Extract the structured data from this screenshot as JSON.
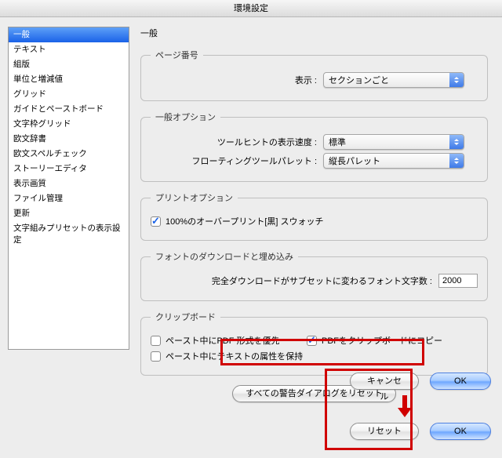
{
  "window": {
    "title": "環境設定"
  },
  "sidebar": {
    "items": [
      "一般",
      "テキスト",
      "組版",
      "単位と増減値",
      "グリッド",
      "ガイドとペーストボード",
      "文字枠グリッド",
      "欧文辞書",
      "欧文スペルチェック",
      "ストーリーエディタ",
      "表示画質",
      "ファイル管理",
      "更新",
      "文字組みプリセットの表示設定"
    ],
    "selectedIndex": 0
  },
  "main": {
    "heading": "一般",
    "pageNumber": {
      "legend": "ページ番号",
      "display_label": "表示 :",
      "value": "セクションごと"
    },
    "general": {
      "legend": "一般オプション",
      "tooltip_label": "ツールヒントの表示速度 :",
      "tooltip_value": "標準",
      "floating_label": "フローティングツールパレット :",
      "floating_value": "縦長パレット"
    },
    "print": {
      "legend": "プリントオプション",
      "overprint_label": "100%のオーバープリント[黒] スウォッチ",
      "overprint_checked": true
    },
    "font": {
      "legend": "フォントのダウンロードと埋め込み",
      "subset_label": "完全ダウンロードがサブセットに変わるフォント文字数 :",
      "subset_value": "2000"
    },
    "clipboard": {
      "legend": "クリップボード",
      "pdf_first_label": "ペースト中にPDF 形式を優先",
      "pdf_first_checked": false,
      "pdf_copy_label": "PDFをクリップボードにコピー",
      "pdf_copy_checked": true,
      "keep_attrs_label": "ペースト中にテキストの属性を保持",
      "keep_attrs_checked": false
    },
    "reset_warnings_label": "すべての警告ダイアログをリセット"
  },
  "buttons": {
    "cancel": "キャンセル",
    "ok": "OK",
    "reset": "リセット"
  }
}
